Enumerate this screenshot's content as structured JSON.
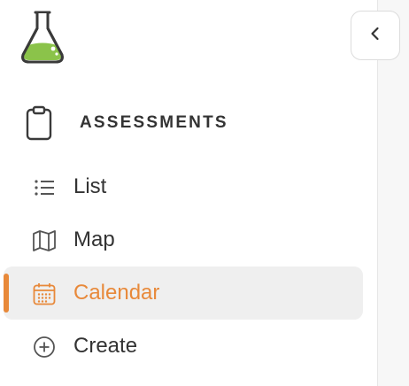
{
  "sidebar": {
    "section_title": "ASSESSMENTS",
    "items": [
      {
        "label": "List",
        "icon": "list-icon"
      },
      {
        "label": "Map",
        "icon": "map-icon"
      },
      {
        "label": "Calendar",
        "icon": "calendar-icon",
        "active": true
      },
      {
        "label": "Create",
        "icon": "plus-circle-icon"
      }
    ]
  },
  "colors": {
    "accent": "#e8893a",
    "text": "#333333",
    "icon": "#555555",
    "active_bg": "#efefef",
    "logo_liquid": "#8bc34a"
  }
}
